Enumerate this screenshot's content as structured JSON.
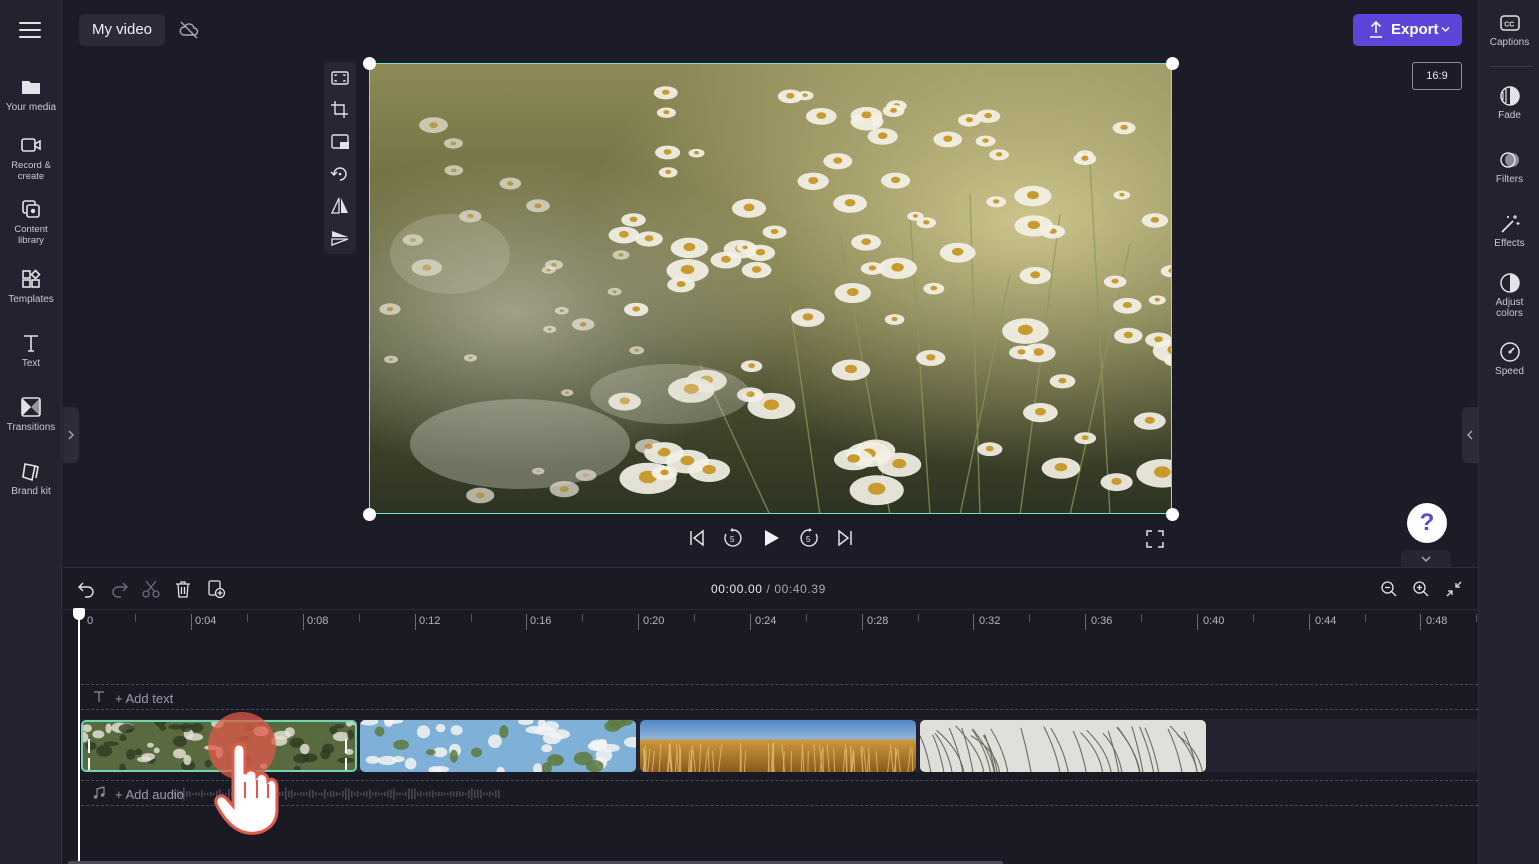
{
  "app": {
    "project_title": "My video",
    "export_label": "Export",
    "aspect_ratio": "16:9",
    "help_glyph": "?",
    "accent_color": "#5b46d9",
    "selection_color": "#7ce0c0"
  },
  "left_nav": {
    "menu_icon": "hamburger-icon",
    "items": [
      {
        "label": "Your media",
        "icon": "folder-icon"
      },
      {
        "label": "Record & create",
        "icon": "video-camera-icon"
      },
      {
        "label": "Content library",
        "icon": "content-library-icon"
      },
      {
        "label": "Templates",
        "icon": "templates-icon"
      },
      {
        "label": "Text",
        "icon": "text-icon"
      },
      {
        "label": "Transitions",
        "icon": "transitions-icon"
      },
      {
        "label": "Brand kit",
        "icon": "brand-kit-icon"
      }
    ]
  },
  "right_nav": {
    "items": [
      {
        "label": "Captions",
        "icon": "captions-icon"
      },
      {
        "label": "Fade",
        "icon": "fade-icon"
      },
      {
        "label": "Filters",
        "icon": "filters-icon"
      },
      {
        "label": "Effects",
        "icon": "effects-icon"
      },
      {
        "label": "Adjust colors",
        "icon": "adjust-colors-icon"
      },
      {
        "label": "Speed",
        "icon": "speed-icon"
      }
    ]
  },
  "preview_tools": [
    "fit-icon",
    "crop-icon",
    "picture-in-picture-icon",
    "rotate-icon",
    "flip-horizontal-icon",
    "flip-vertical-icon"
  ],
  "player": {
    "controls": [
      "skip-back-icon",
      "rewind-5-icon",
      "play-icon",
      "forward-5-icon",
      "skip-forward-icon",
      "fullscreen-icon"
    ]
  },
  "timeline": {
    "current_time": "00:00.00",
    "separator": " / ",
    "total_time": "00:40.39",
    "ticks": [
      "0",
      "0:04",
      "0:08",
      "0:12",
      "0:16",
      "0:20",
      "0:24",
      "0:28",
      "0:32",
      "0:36",
      "0:40",
      "0:44",
      "0:48"
    ],
    "add_text_label": "+ Add text",
    "add_audio_label": "+ Add audio",
    "clips": [
      {
        "name": "daisy-field-clip",
        "selected": true
      },
      {
        "name": "white-flowers-sky-clip",
        "selected": false
      },
      {
        "name": "wheat-field-clip",
        "selected": false
      },
      {
        "name": "grass-stalks-clip",
        "selected": false
      }
    ]
  }
}
